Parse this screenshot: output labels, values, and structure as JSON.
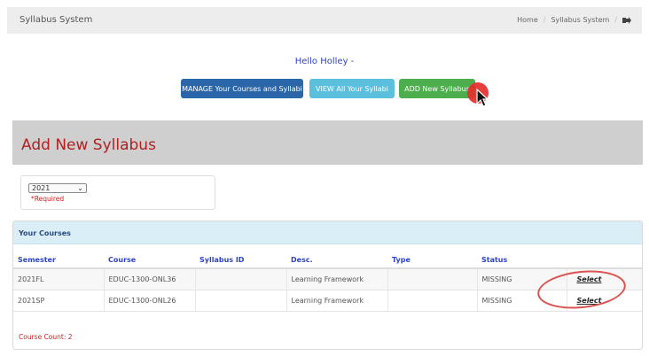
{
  "app": {
    "title": "Syllabus System"
  },
  "breadcrumbs": [
    "Home",
    "Syllabus System"
  ],
  "greeting": "Hello Holley -",
  "buttons": {
    "manage": "MANAGE Your Courses and Syllabi",
    "view": "VIEW All Your Syllabi",
    "add": "ADD New Syllabus"
  },
  "page_title": "Add New Syllabus",
  "filter": {
    "year": "2021",
    "required_note": "*Required"
  },
  "courses": {
    "heading": "Your Courses",
    "columns": [
      "Semester",
      "Course",
      "Syllabus ID",
      "Desc.",
      "Type",
      "Status",
      ""
    ],
    "rows": [
      {
        "semester": "2021FL",
        "course": "EDUC-1300-ONL36",
        "syllabus_id": "",
        "desc": "Learning Framework",
        "type": "",
        "status": "MISSING",
        "action": "Select"
      },
      {
        "semester": "2021SP",
        "course": "EDUC-1300-ONL26",
        "syllabus_id": "",
        "desc": "Learning Framework",
        "type": "",
        "status": "MISSING",
        "action": "Select"
      }
    ],
    "count": "Course Count: 2"
  },
  "icons": {
    "logout": "sign-out-icon",
    "dropdown": "chevron-down-icon",
    "cursor": "pointer-cursor-icon"
  },
  "colors": {
    "manage": "#2a66a8",
    "view": "#5bc0de",
    "add": "#4cae4c",
    "title": "#b02020",
    "highlight": "#d9534f"
  }
}
